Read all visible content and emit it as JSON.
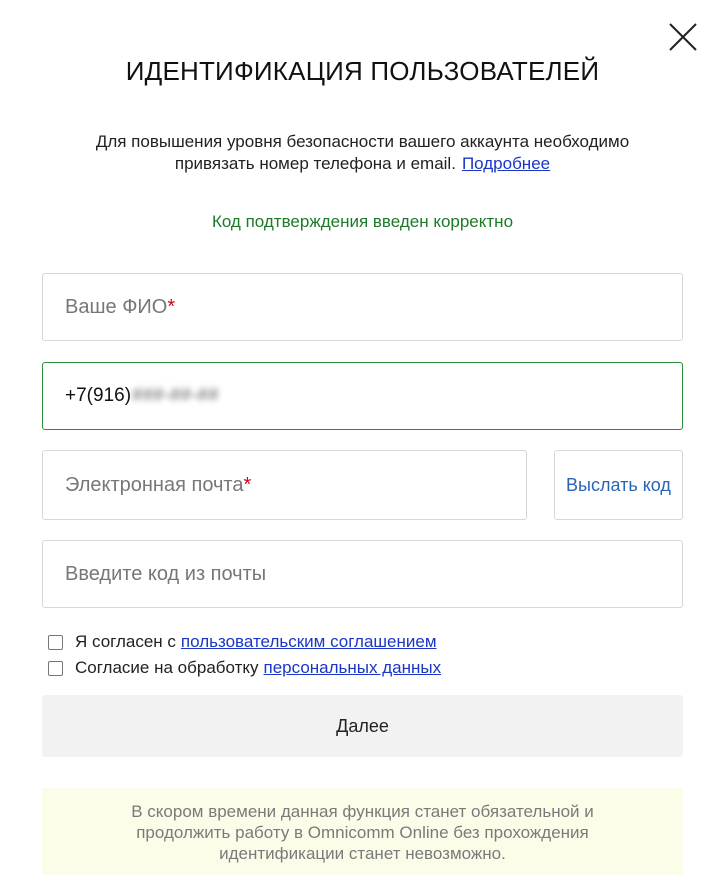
{
  "dialog": {
    "title": "ИДЕНТИФИКАЦИЯ ПОЛЬЗОВАТЕЛЕЙ",
    "intro_line1": "Для повышения уровня безопасности вашего аккаунта необходимо",
    "intro_line2": "привязать номер телефона и email.",
    "intro_link": "Подробнее",
    "success_message": "Код подтверждения введен корректно"
  },
  "form": {
    "fio_placeholder": "Ваше ФИО",
    "phone_visible": "+7(916)",
    "phone_masked": "###-##-##",
    "email_placeholder": "Электронная почта",
    "required_mark": "*",
    "send_code_label": "Выслать код",
    "code_placeholder": "Введите код из почты"
  },
  "consents": [
    {
      "text": "Я согласен с",
      "link": "пользовательским соглашением",
      "checked": false
    },
    {
      "text": "Согласие на обработку",
      "link": "персональных данных",
      "checked": false
    }
  ],
  "next_label": "Далее",
  "notice": {
    "line1": "В скором времени данная функция станет обязательной и",
    "line2": "продолжить работу в Omnicomm Online без прохождения",
    "line3": "идентификации станет невозможно."
  },
  "colors": {
    "success": "#1d7a2a",
    "link": "#1a36c6",
    "send_code": "#2a64b5",
    "required": "#d0021b",
    "notice_bg": "#fcfde9"
  }
}
